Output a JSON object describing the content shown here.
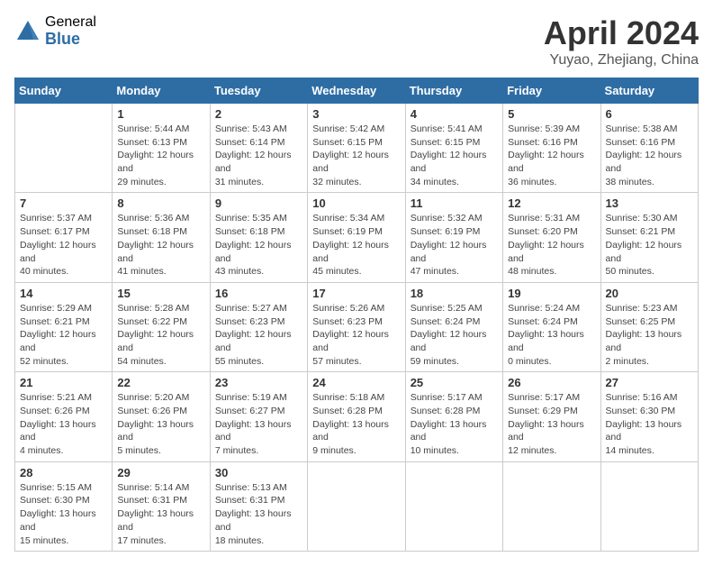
{
  "header": {
    "logo_general": "General",
    "logo_blue": "Blue",
    "title": "April 2024",
    "location": "Yuyao, Zhejiang, China"
  },
  "weekdays": [
    "Sunday",
    "Monday",
    "Tuesday",
    "Wednesday",
    "Thursday",
    "Friday",
    "Saturday"
  ],
  "weeks": [
    [
      {
        "day": null
      },
      {
        "day": 1,
        "sunrise": "5:44 AM",
        "sunset": "6:13 PM",
        "daylight": "12 hours and 29 minutes."
      },
      {
        "day": 2,
        "sunrise": "5:43 AM",
        "sunset": "6:14 PM",
        "daylight": "12 hours and 31 minutes."
      },
      {
        "day": 3,
        "sunrise": "5:42 AM",
        "sunset": "6:15 PM",
        "daylight": "12 hours and 32 minutes."
      },
      {
        "day": 4,
        "sunrise": "5:41 AM",
        "sunset": "6:15 PM",
        "daylight": "12 hours and 34 minutes."
      },
      {
        "day": 5,
        "sunrise": "5:39 AM",
        "sunset": "6:16 PM",
        "daylight": "12 hours and 36 minutes."
      },
      {
        "day": 6,
        "sunrise": "5:38 AM",
        "sunset": "6:16 PM",
        "daylight": "12 hours and 38 minutes."
      }
    ],
    [
      {
        "day": 7,
        "sunrise": "5:37 AM",
        "sunset": "6:17 PM",
        "daylight": "12 hours and 40 minutes."
      },
      {
        "day": 8,
        "sunrise": "5:36 AM",
        "sunset": "6:18 PM",
        "daylight": "12 hours and 41 minutes."
      },
      {
        "day": 9,
        "sunrise": "5:35 AM",
        "sunset": "6:18 PM",
        "daylight": "12 hours and 43 minutes."
      },
      {
        "day": 10,
        "sunrise": "5:34 AM",
        "sunset": "6:19 PM",
        "daylight": "12 hours and 45 minutes."
      },
      {
        "day": 11,
        "sunrise": "5:32 AM",
        "sunset": "6:19 PM",
        "daylight": "12 hours and 47 minutes."
      },
      {
        "day": 12,
        "sunrise": "5:31 AM",
        "sunset": "6:20 PM",
        "daylight": "12 hours and 48 minutes."
      },
      {
        "day": 13,
        "sunrise": "5:30 AM",
        "sunset": "6:21 PM",
        "daylight": "12 hours and 50 minutes."
      }
    ],
    [
      {
        "day": 14,
        "sunrise": "5:29 AM",
        "sunset": "6:21 PM",
        "daylight": "12 hours and 52 minutes."
      },
      {
        "day": 15,
        "sunrise": "5:28 AM",
        "sunset": "6:22 PM",
        "daylight": "12 hours and 54 minutes."
      },
      {
        "day": 16,
        "sunrise": "5:27 AM",
        "sunset": "6:23 PM",
        "daylight": "12 hours and 55 minutes."
      },
      {
        "day": 17,
        "sunrise": "5:26 AM",
        "sunset": "6:23 PM",
        "daylight": "12 hours and 57 minutes."
      },
      {
        "day": 18,
        "sunrise": "5:25 AM",
        "sunset": "6:24 PM",
        "daylight": "12 hours and 59 minutes."
      },
      {
        "day": 19,
        "sunrise": "5:24 AM",
        "sunset": "6:24 PM",
        "daylight": "13 hours and 0 minutes."
      },
      {
        "day": 20,
        "sunrise": "5:23 AM",
        "sunset": "6:25 PM",
        "daylight": "13 hours and 2 minutes."
      }
    ],
    [
      {
        "day": 21,
        "sunrise": "5:21 AM",
        "sunset": "6:26 PM",
        "daylight": "13 hours and 4 minutes."
      },
      {
        "day": 22,
        "sunrise": "5:20 AM",
        "sunset": "6:26 PM",
        "daylight": "13 hours and 5 minutes."
      },
      {
        "day": 23,
        "sunrise": "5:19 AM",
        "sunset": "6:27 PM",
        "daylight": "13 hours and 7 minutes."
      },
      {
        "day": 24,
        "sunrise": "5:18 AM",
        "sunset": "6:28 PM",
        "daylight": "13 hours and 9 minutes."
      },
      {
        "day": 25,
        "sunrise": "5:17 AM",
        "sunset": "6:28 PM",
        "daylight": "13 hours and 10 minutes."
      },
      {
        "day": 26,
        "sunrise": "5:17 AM",
        "sunset": "6:29 PM",
        "daylight": "13 hours and 12 minutes."
      },
      {
        "day": 27,
        "sunrise": "5:16 AM",
        "sunset": "6:30 PM",
        "daylight": "13 hours and 14 minutes."
      }
    ],
    [
      {
        "day": 28,
        "sunrise": "5:15 AM",
        "sunset": "6:30 PM",
        "daylight": "13 hours and 15 minutes."
      },
      {
        "day": 29,
        "sunrise": "5:14 AM",
        "sunset": "6:31 PM",
        "daylight": "13 hours and 17 minutes."
      },
      {
        "day": 30,
        "sunrise": "5:13 AM",
        "sunset": "6:31 PM",
        "daylight": "13 hours and 18 minutes."
      },
      {
        "day": null
      },
      {
        "day": null
      },
      {
        "day": null
      },
      {
        "day": null
      }
    ]
  ]
}
